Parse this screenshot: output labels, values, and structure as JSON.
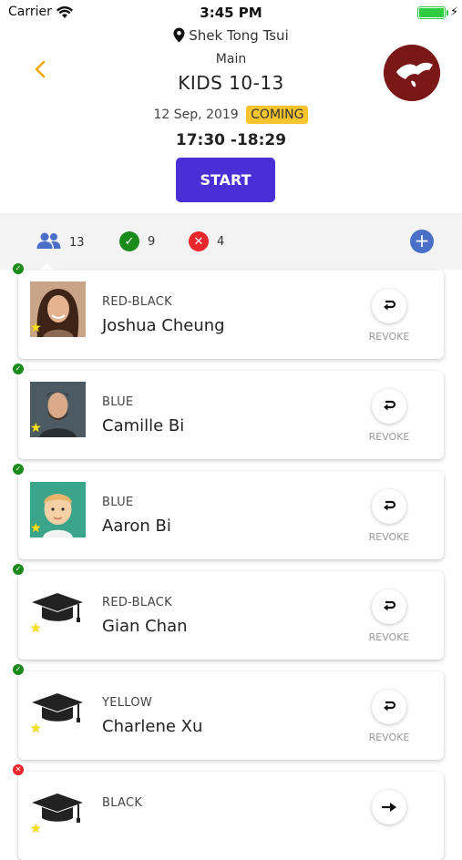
{
  "status_bar": {
    "carrier": "Carrier",
    "time": "3:45 PM",
    "battery_level": 1.0
  },
  "header": {
    "location": "Shek Tong Tsui",
    "room": "Main",
    "class_title": "KIDS 10-13",
    "date": "12 Sep,  2019",
    "status_badge": "COMING",
    "time_range": "17:30 -18:29",
    "start_label": "START"
  },
  "stats": {
    "total": "13",
    "present": "9",
    "absent": "4"
  },
  "colors": {
    "accent": "#4b2fd6",
    "back": "#f2a900",
    "present": "#1a8a1a",
    "absent": "#e8262b",
    "badge": "#f7c52b"
  },
  "students": [
    {
      "belt": "RED-BLACK",
      "name": "Joshua Cheung",
      "status": "present",
      "avatar": "photo-woman",
      "action": "REVOKE",
      "action_icon": "revoke-icon"
    },
    {
      "belt": "BLUE",
      "name": "Camille Bi",
      "status": "present",
      "avatar": "photo-man",
      "action": "REVOKE",
      "action_icon": "revoke-icon"
    },
    {
      "belt": "BLUE",
      "name": "Aaron Bi",
      "status": "present",
      "avatar": "cartoon-boy",
      "action": "REVOKE",
      "action_icon": "revoke-icon"
    },
    {
      "belt": "RED-BLACK",
      "name": "Gian Chan",
      "status": "present",
      "avatar": "graduation-cap",
      "action": "REVOKE",
      "action_icon": "revoke-icon"
    },
    {
      "belt": "YELLOW",
      "name": "Charlene  Xu",
      "status": "present",
      "avatar": "graduation-cap",
      "action": "REVOKE",
      "action_icon": "revoke-icon"
    },
    {
      "belt": "BLACK",
      "name": "",
      "status": "absent",
      "avatar": "graduation-cap",
      "action": "",
      "action_icon": "check-in-icon"
    }
  ]
}
